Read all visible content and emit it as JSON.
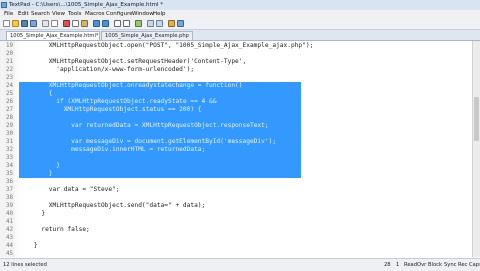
{
  "window": {
    "title": "TextPad - C:\\Users\\...\\1005_Simple_Ajax_Example.html *"
  },
  "menu": [
    "File",
    "Edit",
    "Search",
    "View",
    "Tools",
    "Macros",
    "Configure",
    "Window",
    "Help"
  ],
  "tabs": [
    {
      "label": "1005_Simple_Ajax_Example.html*",
      "active": true
    },
    {
      "label": "1005_Simple_Ajax_Example.php",
      "active": false
    }
  ],
  "editor": {
    "lines": [
      {
        "no": "19",
        "text": "        XMLHttpRequestObject.open(\"POST\", \"1005_Simple_Ajax_Example_ajax.php\");",
        "selected": false
      },
      {
        "no": "20",
        "text": "",
        "selected": false
      },
      {
        "no": "21",
        "text": "        XMLHttpRequestObject.setRequestHeader('Content-Type',",
        "selected": false
      },
      {
        "no": "22",
        "text": "          'application/x-www-form-urlencoded');",
        "selected": false
      },
      {
        "no": "23",
        "text": "",
        "selected": false
      },
      {
        "no": "24",
        "text": "        XMLHttpRequestObject.onreadystatechange = function()",
        "selected": true
      },
      {
        "no": "25",
        "text": "        {",
        "selected": true
      },
      {
        "no": "26",
        "text": "          if (XMLHttpRequestObject.readyState == 4 &&",
        "selected": true
      },
      {
        "no": "27",
        "text": "            XMLHttpRequestObject.status == 200) {",
        "selected": true
      },
      {
        "no": "28",
        "text": "",
        "selected": true
      },
      {
        "no": "29",
        "text": "              var returnedData = XMLHttpRequestObject.responseText;",
        "selected": true
      },
      {
        "no": "30",
        "text": "",
        "selected": true
      },
      {
        "no": "31",
        "text": "              var messageDiv = document.getElementById('messageDiv');",
        "selected": true
      },
      {
        "no": "32",
        "text": "              messageDiv.innerHTML = returnedData;",
        "selected": true
      },
      {
        "no": "33",
        "text": "",
        "selected": true
      },
      {
        "no": "34",
        "text": "          }",
        "selected": true
      },
      {
        "no": "35",
        "text": "        }",
        "selected": true
      },
      {
        "no": "36",
        "text": "",
        "selected": false
      },
      {
        "no": "37",
        "text": "        var data = \"Steve\";",
        "selected": false
      },
      {
        "no": "38",
        "text": "",
        "selected": false
      },
      {
        "no": "39",
        "text": "        XMLHttpRequestObject.send(\"data=\" + data);",
        "selected": false
      },
      {
        "no": "40",
        "text": "      }",
        "selected": false
      },
      {
        "no": "41",
        "text": "",
        "selected": false
      },
      {
        "no": "42",
        "text": "      return false;",
        "selected": false
      },
      {
        "no": "43",
        "text": "",
        "selected": false
      },
      {
        "no": "44",
        "text": "    }",
        "selected": false
      },
      {
        "no": "45",
        "text": "",
        "selected": false
      }
    ]
  },
  "status": {
    "left": "12 lines selected",
    "line": "28",
    "col": "1",
    "mode": "Read",
    "ovr": "Ovr",
    "block": "Block",
    "sync": "Sync",
    "rec": "Rec",
    "caps": "Caps"
  },
  "colors": {
    "selection": "#3399ff",
    "titlebar": "#d8e4f2"
  }
}
